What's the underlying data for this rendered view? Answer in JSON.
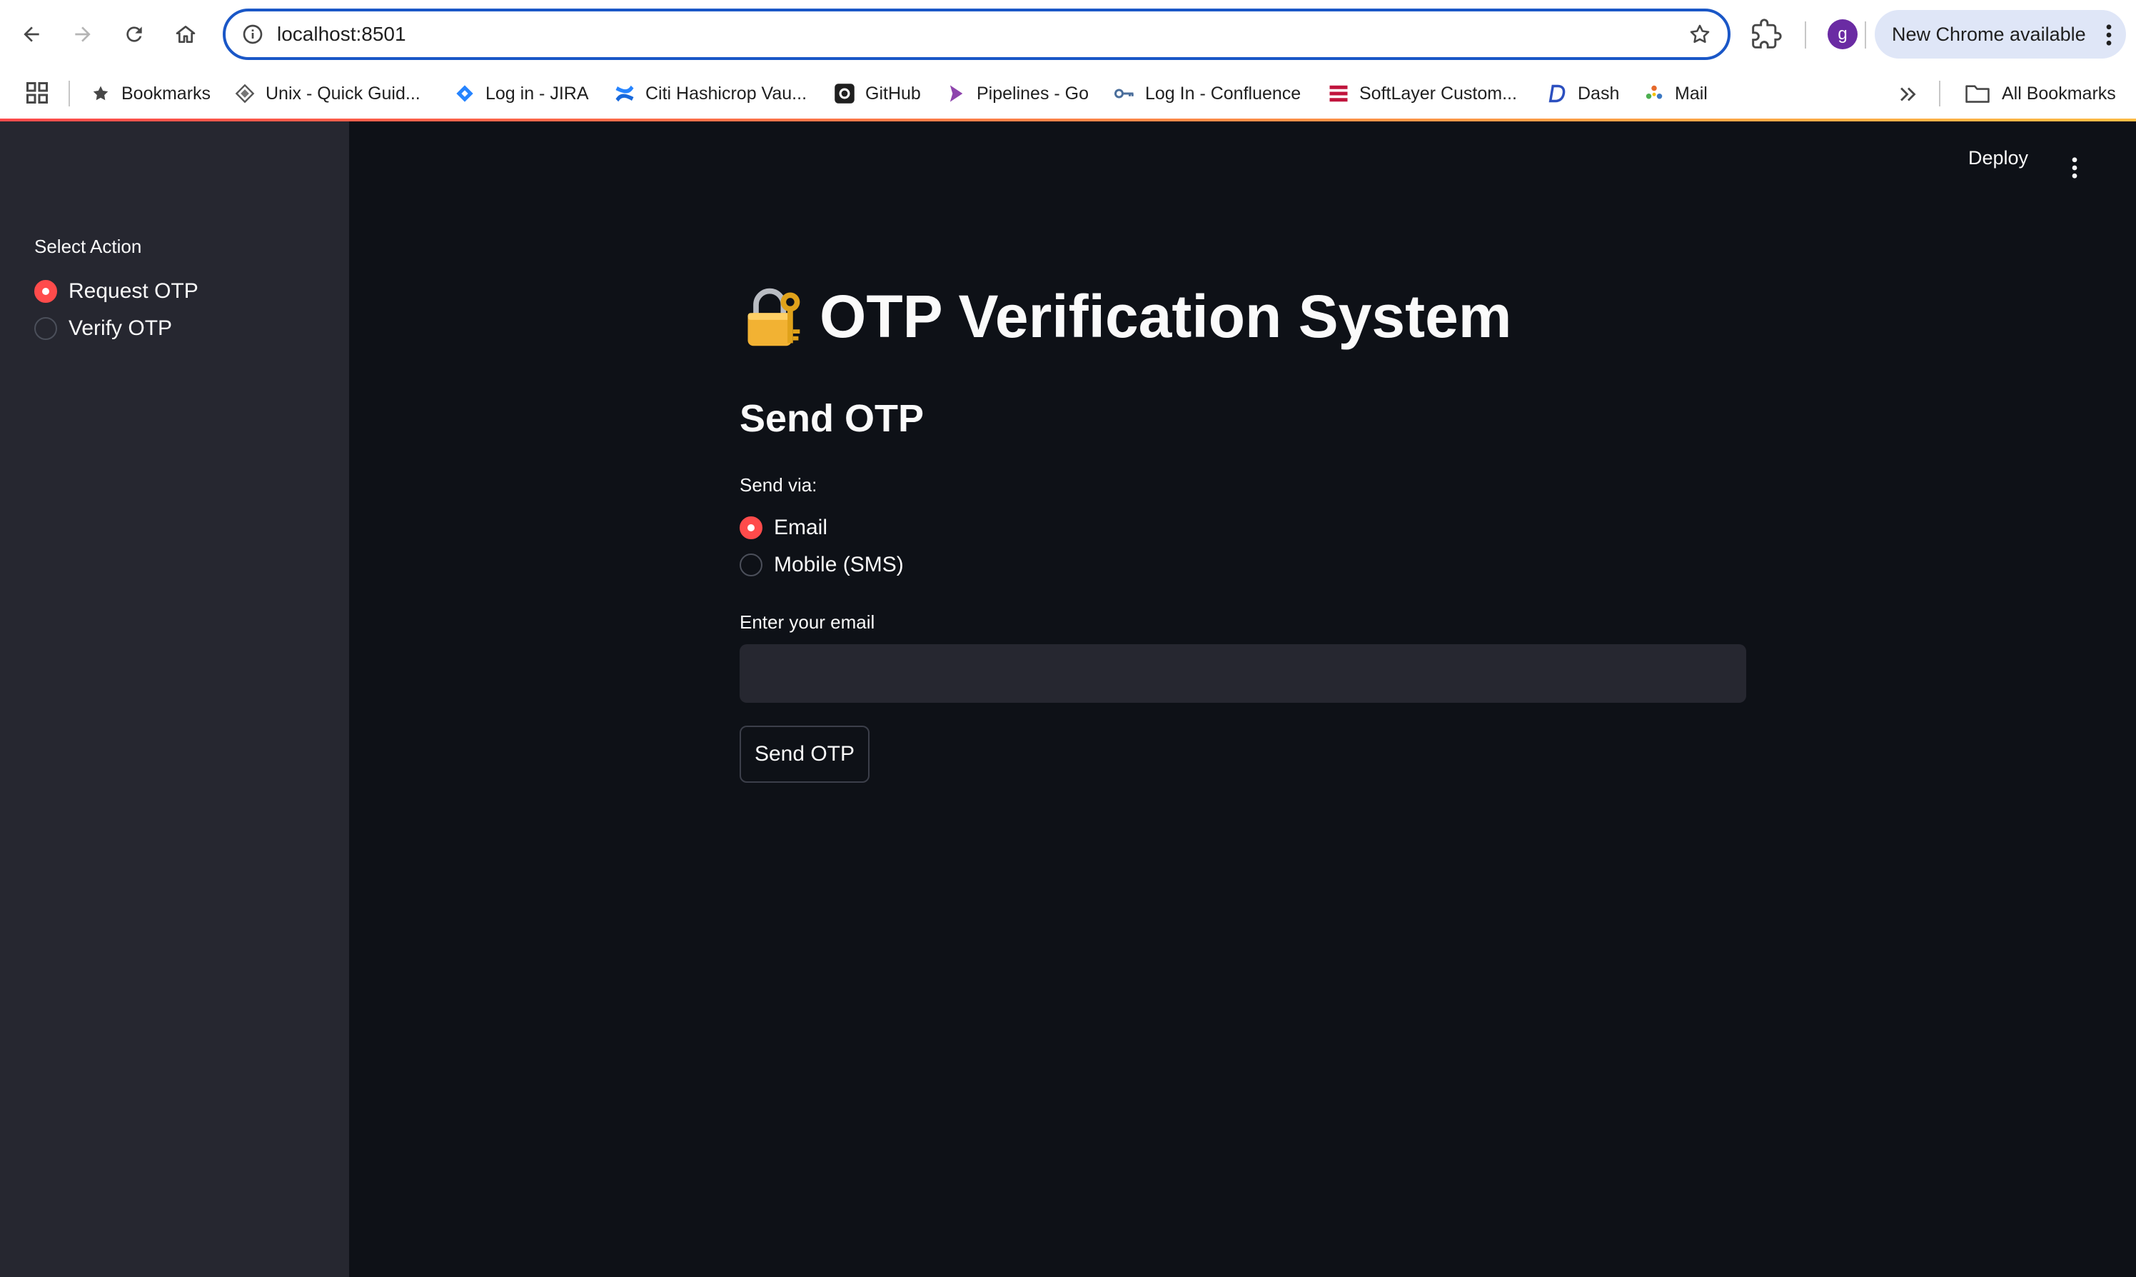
{
  "browser": {
    "url": "localhost:8501",
    "profile_initial": "g",
    "update_label": "New Chrome available",
    "bookmarks": [
      {
        "label": "Bookmarks",
        "icon": "star-icon"
      },
      {
        "label": "Unix - Quick Guid...",
        "icon": "unix-icon"
      },
      {
        "label": "Log in - JIRA",
        "icon": "jira-icon"
      },
      {
        "label": "Citi Hashicrop Vau...",
        "icon": "confluence-icon"
      },
      {
        "label": "GitHub",
        "icon": "github-icon"
      },
      {
        "label": "Pipelines - Go",
        "icon": "gocd-icon"
      },
      {
        "label": "Log In - Confluence",
        "icon": "key-icon"
      },
      {
        "label": "SoftLayer Custom...",
        "icon": "softlayer-icon"
      },
      {
        "label": "Dash",
        "icon": "dash-icon"
      },
      {
        "label": "Mail",
        "icon": "mail-icon"
      }
    ],
    "all_bookmarks_label": "All Bookmarks"
  },
  "app": {
    "deploy_label": "Deploy",
    "title": "OTP Verification System",
    "title_icon": "lock-key-icon",
    "accent_color": "#ff4b4b",
    "sidebar": {
      "label": "Select Action",
      "options": [
        {
          "label": "Request OTP",
          "selected": true
        },
        {
          "label": "Verify OTP",
          "selected": false
        }
      ]
    },
    "section_title": "Send OTP",
    "send_via": {
      "label": "Send via:",
      "options": [
        {
          "label": "Email",
          "selected": true
        },
        {
          "label": "Mobile (SMS)",
          "selected": false
        }
      ]
    },
    "email_field": {
      "label": "Enter your email",
      "value": "",
      "placeholder": ""
    },
    "send_button_label": "Send OTP"
  }
}
